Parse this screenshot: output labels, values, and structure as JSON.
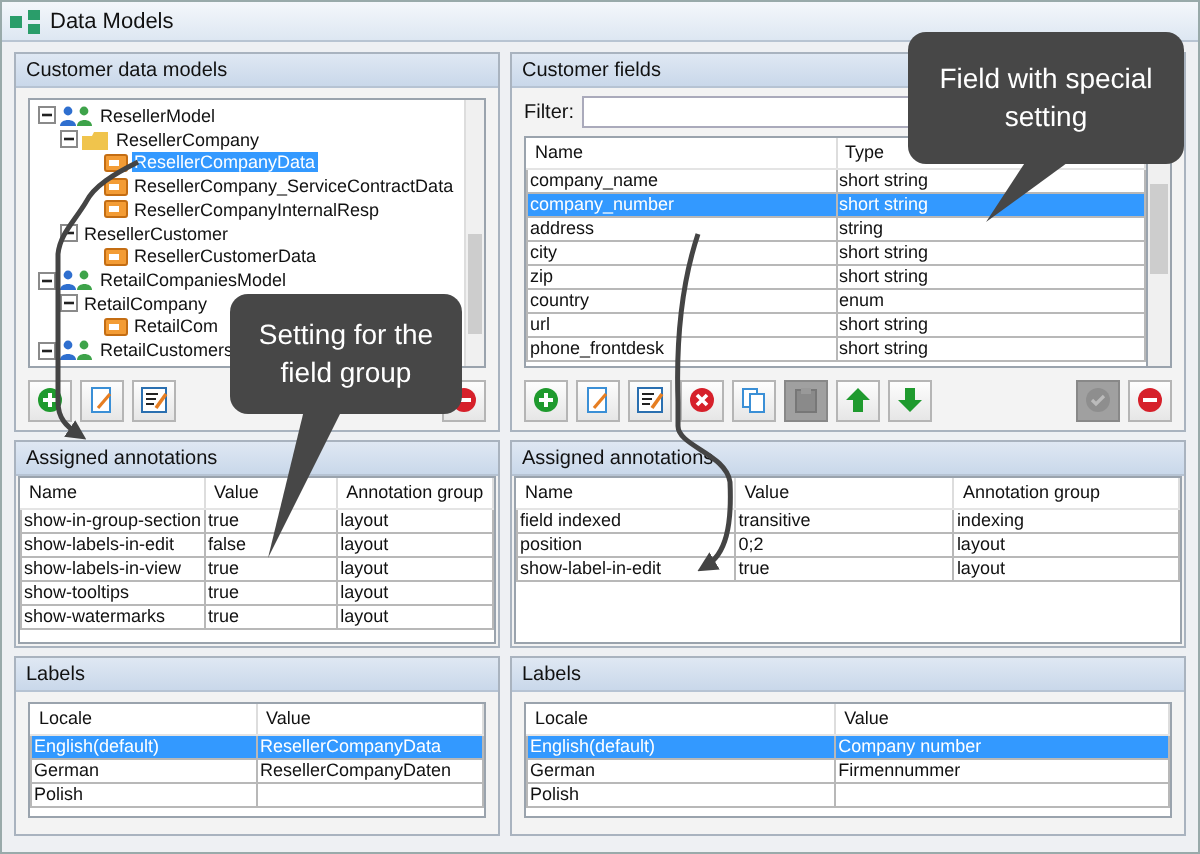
{
  "window": {
    "title": "Data Models"
  },
  "models_panel": {
    "title": "Customer data models",
    "tree": [
      {
        "label": "ResellerModel",
        "kind": "model",
        "expanded": true,
        "selected": false,
        "children": [
          {
            "label": "ResellerCompany",
            "kind": "folder",
            "expanded": true,
            "selected": false,
            "children": [
              {
                "label": "ResellerCompanyData",
                "kind": "data",
                "selected": true
              },
              {
                "label": "ResellerCompany_ServiceContractData",
                "kind": "data",
                "selected": false
              },
              {
                "label": "ResellerCompanyInternalResp",
                "kind": "data",
                "selected": false
              }
            ]
          },
          {
            "label": "ResellerCustomer",
            "kind": "group",
            "expanded": true,
            "selected": false,
            "children": [
              {
                "label": "ResellerCustomerData",
                "kind": "data",
                "selected": false
              }
            ]
          }
        ]
      },
      {
        "label": "RetailCompaniesModel",
        "kind": "model",
        "expanded": true,
        "selected": false,
        "children": [
          {
            "label": "RetailCompany",
            "kind": "group",
            "expanded": true,
            "selected": false,
            "children": [
              {
                "label": "RetailCom",
                "kind": "data",
                "selected": false
              }
            ]
          }
        ]
      },
      {
        "label": "RetailCustomers",
        "kind": "model",
        "expanded": true,
        "selected": false
      }
    ],
    "toolbar": {
      "left": [
        {
          "kind": "add",
          "disabled": false
        },
        {
          "kind": "edit",
          "disabled": false
        },
        {
          "kind": "edit-list",
          "disabled": false
        }
      ],
      "right": [
        {
          "kind": "remove",
          "disabled": false
        }
      ]
    }
  },
  "fields_panel": {
    "title": "Customer fields",
    "filter": {
      "label": "Filter:"
    },
    "columns": [
      "Name",
      "Type"
    ],
    "rows": [
      {
        "cells": [
          "company_name",
          "short string"
        ],
        "selected": false
      },
      {
        "cells": [
          "company_number",
          "short string"
        ],
        "selected": true
      },
      {
        "cells": [
          "address",
          "string"
        ],
        "selected": false
      },
      {
        "cells": [
          "city",
          "short string"
        ],
        "selected": false
      },
      {
        "cells": [
          "zip",
          "short string"
        ],
        "selected": false
      },
      {
        "cells": [
          "country",
          "enum"
        ],
        "selected": false
      },
      {
        "cells": [
          "url",
          "short string"
        ],
        "selected": false
      },
      {
        "cells": [
          "phone_frontdesk",
          "short string"
        ],
        "selected": false
      }
    ],
    "toolbar": {
      "left": [
        {
          "kind": "add",
          "disabled": false
        },
        {
          "kind": "edit",
          "disabled": false
        },
        {
          "kind": "edit-list",
          "disabled": false
        },
        {
          "kind": "delete",
          "disabled": false
        },
        {
          "kind": "copy",
          "disabled": false
        },
        {
          "kind": "paste",
          "disabled": true
        },
        {
          "kind": "up",
          "disabled": false
        },
        {
          "kind": "down",
          "disabled": false
        }
      ],
      "right": [
        {
          "kind": "check",
          "disabled": true
        },
        {
          "kind": "remove",
          "disabled": false
        }
      ]
    }
  },
  "left_annotations": {
    "title": "Assigned annotations",
    "columns": [
      "Name",
      "Value",
      "Annotation group"
    ],
    "rows": [
      {
        "cells": [
          "show-in-group-section",
          "true",
          "layout"
        ],
        "selected": false
      },
      {
        "cells": [
          "show-labels-in-edit",
          "false",
          "layout"
        ],
        "selected": false
      },
      {
        "cells": [
          "show-labels-in-view",
          "true",
          "layout"
        ],
        "selected": false
      },
      {
        "cells": [
          "show-tooltips",
          "true",
          "layout"
        ],
        "selected": false
      },
      {
        "cells": [
          "show-watermarks",
          "true",
          "layout"
        ],
        "selected": false
      }
    ]
  },
  "right_annotations": {
    "title": "Assigned annotations",
    "columns": [
      "Name",
      "Value",
      "Annotation group"
    ],
    "rows": [
      {
        "cells": [
          "field indexed",
          "transitive",
          "indexing"
        ],
        "selected": false
      },
      {
        "cells": [
          "position",
          "0;2",
          "layout"
        ],
        "selected": false
      },
      {
        "cells": [
          "show-label-in-edit",
          "true",
          "layout"
        ],
        "selected": false
      }
    ]
  },
  "left_labels": {
    "title": "Labels",
    "columns": [
      "Locale",
      "Value"
    ],
    "rows": [
      {
        "cells": [
          "English(default)",
          "ResellerCompanyData"
        ],
        "selected": true
      },
      {
        "cells": [
          "German",
          "ResellerCompanyDaten"
        ],
        "selected": false
      },
      {
        "cells": [
          "Polish",
          ""
        ],
        "selected": false
      }
    ]
  },
  "right_labels": {
    "title": "Labels",
    "columns": [
      "Locale",
      "Value"
    ],
    "rows": [
      {
        "cells": [
          "English(default)",
          "Company number"
        ],
        "selected": true
      },
      {
        "cells": [
          "German",
          "Firmennummer"
        ],
        "selected": false
      },
      {
        "cells": [
          "Polish",
          ""
        ],
        "selected": false
      }
    ]
  },
  "callouts": [
    {
      "text": "Setting for the field group"
    },
    {
      "text": "Field with special setting"
    }
  ]
}
